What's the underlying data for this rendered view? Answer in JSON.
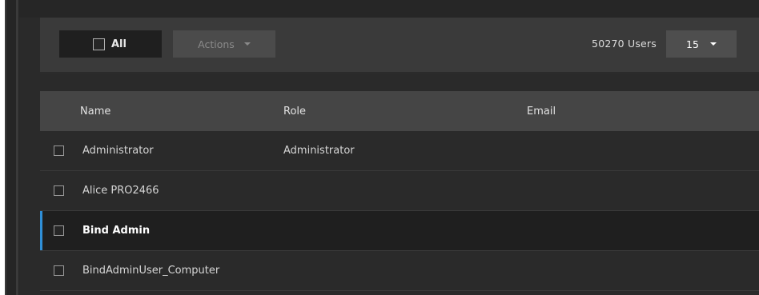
{
  "toolbar": {
    "select_all_label": "All",
    "actions_label": "Actions",
    "user_count": "50270 Users",
    "page_size": "15"
  },
  "table": {
    "columns": [
      "Name",
      "Role",
      "Email"
    ],
    "rows": [
      {
        "name": "Administrator",
        "role": "Administrator",
        "email": ""
      },
      {
        "name": "Alice PRO2466",
        "role": "",
        "email": ""
      },
      {
        "name": "Bind Admin",
        "role": "",
        "email": ""
      },
      {
        "name": "BindAdminUser_Computer",
        "role": "",
        "email": ""
      }
    ],
    "selected_row_index": 2
  },
  "colors": {
    "background": "#2a2a2a",
    "toolbar_bg": "#3a3a3a",
    "header_bg": "#454545",
    "selected_row_bg": "#1f1f1f",
    "selection_accent": "#2f8fd8"
  },
  "icons": {
    "caret": "chevron-down-icon",
    "checkbox": "checkbox-icon"
  }
}
